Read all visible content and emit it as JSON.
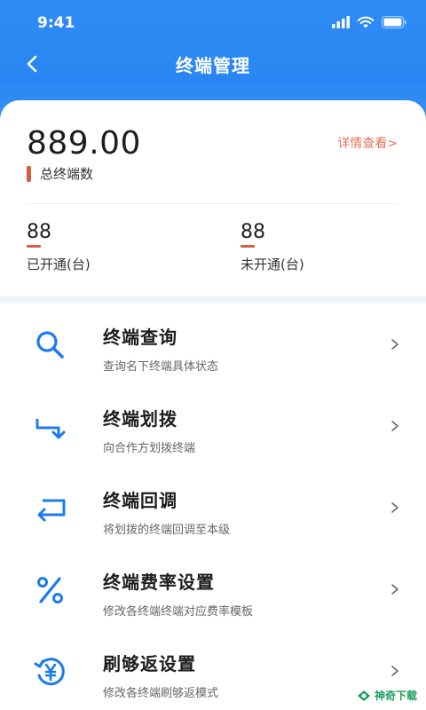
{
  "status_bar": {
    "time": "9:41"
  },
  "nav": {
    "title": "终端管理"
  },
  "summary": {
    "total_value": "889.00",
    "total_label": "总终端数",
    "detail_link": "详情查看>",
    "opened": {
      "value": "88",
      "label": "已开通(台)"
    },
    "unopened": {
      "value": "88",
      "label": "未开通(台)"
    }
  },
  "menu": {
    "items": [
      {
        "title": "终端查询",
        "desc": "查询名下终端具体状态",
        "icon": "search-icon"
      },
      {
        "title": "终端划拨",
        "desc": "向合作方划拨终端",
        "icon": "transfer-icon"
      },
      {
        "title": "终端回调",
        "desc": "将划拨的终端回调至本级",
        "icon": "return-icon"
      },
      {
        "title": "终端费率设置",
        "desc": "修改各终端终端对应费率模板",
        "icon": "percent-icon"
      },
      {
        "title": "刷够返设置",
        "desc": "修改各终端刷够返模式",
        "icon": "yuan-cashback-icon"
      }
    ]
  },
  "watermark": {
    "text": "神奇下载"
  },
  "colors": {
    "header_blue": "#2f8cf5",
    "accent_red": "#d65d3e",
    "link_orange": "#e8705a",
    "icon_blue": "#1a7cf0"
  }
}
